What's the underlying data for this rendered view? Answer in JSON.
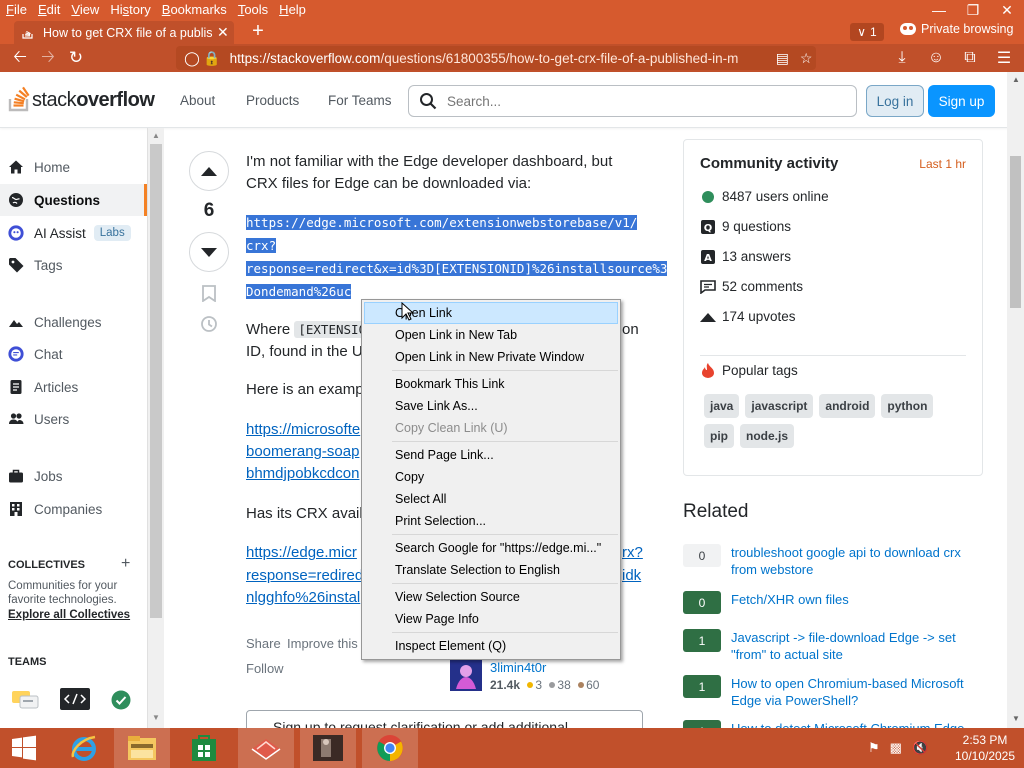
{
  "browser": {
    "menu": [
      "File",
      "Edit",
      "View",
      "History",
      "Bookmarks",
      "Tools",
      "Help"
    ],
    "menu_mnemonics": [
      "F",
      "E",
      "V",
      "s",
      "B",
      "T",
      "H"
    ],
    "tab_title": "How to get CRX file of a publish",
    "tab_count": "1",
    "private_label": "Private browsing",
    "url_host": "https://stackoverflow.com",
    "url_path": "/questions/61800355/how-to-get-crx-file-of-a-published-in-m",
    "colors": {
      "chrome": "#d65a2e",
      "toolbar": "#c0502a"
    }
  },
  "so_header": {
    "logo_stack": "stack",
    "logo_overflow": "overflow",
    "about": "About",
    "products": "Products",
    "for_teams": "For Teams",
    "search_placeholder": "Search...",
    "login": "Log in",
    "signup": "Sign up"
  },
  "leftnav": {
    "home": "Home",
    "questions": "Questions",
    "ai_assist": "AI Assist",
    "labs": "Labs",
    "tags": "Tags",
    "challenges": "Challenges",
    "chat": "Chat",
    "articles": "Articles",
    "users": "Users",
    "jobs": "Jobs",
    "companies": "Companies",
    "collectives_heading": "COLLECTIVES",
    "collectives_desc": "Communities for your favorite technologies.",
    "collectives_link": "Explore all Collectives",
    "teams_heading": "TEAMS"
  },
  "answer": {
    "score": "6",
    "intro_1": "I'm not familiar with the Edge developer dashboard, but",
    "intro_2": "CRX files for Edge can be downloaded via:",
    "code_1": "https://edge.microsoft.com/extensionwebstorebase/v1/",
    "code_2": "crx?",
    "code_3": "response=redirect&x=id%3D[EXTENSIONID]%26installsource%3",
    "code_4": "Dondemand%26uc",
    "where_a": "Where",
    "where_code": "[EXTENSIO",
    "where_b": "on",
    "where_2": "ID, found in the U",
    "example": "Here is an examp",
    "link1_1": "https://microsofte",
    "link1_2": "boomerang-soap",
    "link1_3": "bhmdjpobkcdcon",
    "has_crx": "Has its CRX availa",
    "link2_1a": "https://edge.micr",
    "link2_1b": "rx?",
    "link2_2a": "response=redired",
    "link2_2b": "idk",
    "link2_3": "nlgghfo%26instal",
    "share": "Share",
    "improve": "Improve this",
    "follow": "Follow",
    "signup_prompt": "Sign up to request clarification or add additional"
  },
  "answer_user": {
    "name": "3limin4t0r",
    "rep": "21.4k",
    "gold": "3",
    "silver": "38",
    "bronze": "60"
  },
  "context_menu": {
    "open_link": "Open Link",
    "open_new_tab": "Open Link in New Tab",
    "open_private": "Open Link in New Private Window",
    "bookmark": "Bookmark This Link",
    "save_link": "Save Link As...",
    "copy_clean": "Copy Clean Link (U)",
    "send_link": "Send Page Link...",
    "copy": "Copy",
    "select_all": "Select All",
    "print_sel": "Print Selection...",
    "search_google": "Search Google for \"https://edge.mi...\"",
    "translate": "Translate Selection to English",
    "view_source": "View Selection Source",
    "page_info": "View Page Info",
    "inspect": "Inspect Element (Q)"
  },
  "community": {
    "title": "Community activity",
    "last": "Last 1 hr",
    "users_online": "8487 users online",
    "questions": "9 questions",
    "answers": "13 answers",
    "comments": "52 comments",
    "upvotes": "174 upvotes",
    "popular_tags": "Popular tags",
    "tags": [
      "java",
      "javascript",
      "android",
      "python",
      "pip",
      "node.js"
    ]
  },
  "related": {
    "heading": "Related",
    "items": [
      {
        "score": "0",
        "title": "troubleshoot google api to download crx from webstore"
      },
      {
        "score": "0",
        "title": "Fetch/XHR own files"
      },
      {
        "score": "1",
        "title": "Javascript -> file-download Edge -> set \"from\" to actual site"
      },
      {
        "score": "1",
        "title": "How to open Chromium-based Microsoft Edge via PowerShell?"
      },
      {
        "score": "1",
        "title": "How to detect Microsoft Chromium Edge"
      }
    ]
  },
  "taskbar": {
    "time": "2:53 PM",
    "date": "10/10/2025"
  }
}
